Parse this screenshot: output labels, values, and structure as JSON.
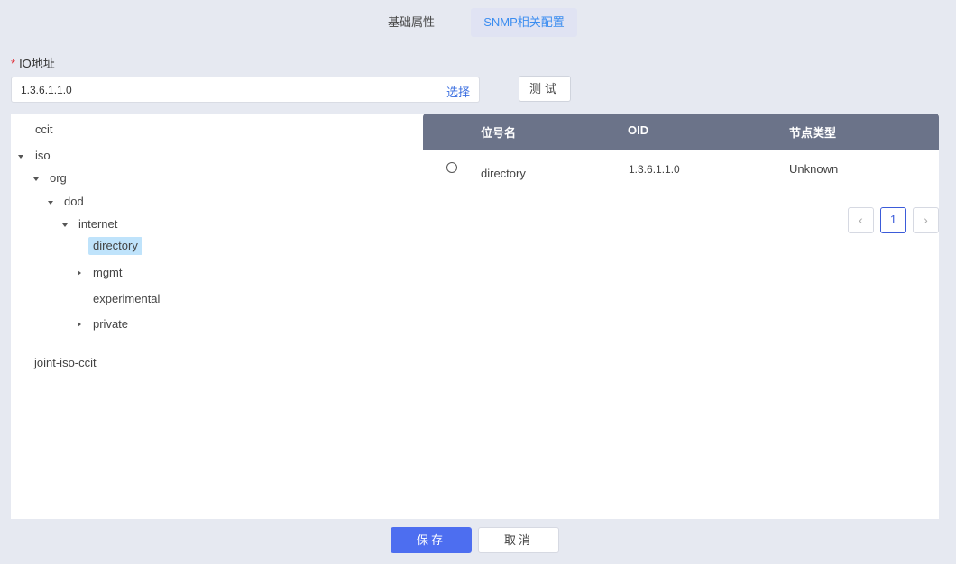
{
  "tabs": [
    {
      "label": "基础属性"
    },
    {
      "label": "SNMP相关配置"
    }
  ],
  "form": {
    "required_mark": "*",
    "io_label": "IO地址",
    "io_value": "1.3.6.1.1.0",
    "select_link": "选择",
    "test_button": "测试"
  },
  "tree": {
    "nodes": [
      {
        "label": "ccit"
      },
      {
        "label": "iso"
      },
      {
        "label": "org"
      },
      {
        "label": "dod"
      },
      {
        "label": "internet"
      },
      {
        "label": "directory"
      },
      {
        "label": "mgmt"
      },
      {
        "label": "experimental"
      },
      {
        "label": "private"
      },
      {
        "label": "joint-iso-ccit"
      }
    ]
  },
  "table": {
    "headers": [
      "位号名",
      "OID",
      "节点类型"
    ],
    "rows": [
      {
        "name": "directory",
        "oid": "1.3.6.1.1.0",
        "type": "Unknown"
      }
    ]
  },
  "pagination": {
    "prev_icon": "‹",
    "current_page": "1",
    "next_icon": "›"
  },
  "footer": {
    "save": "保存",
    "cancel": "取消"
  },
  "colors": {
    "accent": "#4d6ef0",
    "tab_active": "#3b8df0",
    "table_header": "#6b7389",
    "selected_node": "#bfe3fb",
    "required": "#e0303a"
  }
}
